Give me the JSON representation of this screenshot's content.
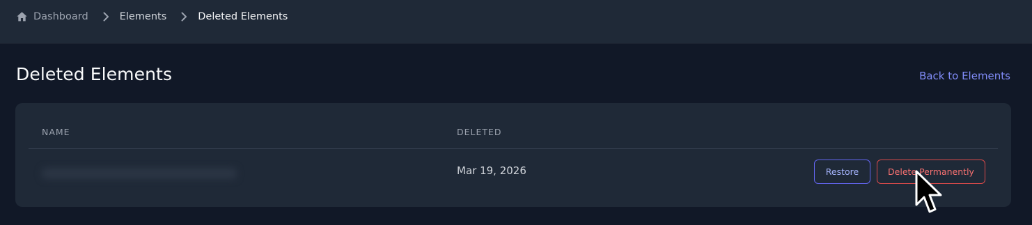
{
  "breadcrumb": {
    "home_label": "Dashboard",
    "elements_label": "Elements",
    "current_label": "Deleted Elements"
  },
  "page": {
    "title": "Deleted Elements",
    "back_link": "Back to Elements"
  },
  "table": {
    "columns": [
      "NAME",
      "DELETED"
    ],
    "rows": [
      {
        "name": "",
        "deleted": "Mar 19, 2026",
        "actions": [
          "Restore",
          "Delete Permanently"
        ]
      }
    ]
  },
  "colors": {
    "background": "#111827",
    "topbar": "#1f2937",
    "card": "#1f2937",
    "accent": "#818cf8",
    "danger": "#f87171"
  },
  "icons": [
    "home-icon",
    "chevron-right-icon",
    "mouse-pointer-icon"
  ]
}
